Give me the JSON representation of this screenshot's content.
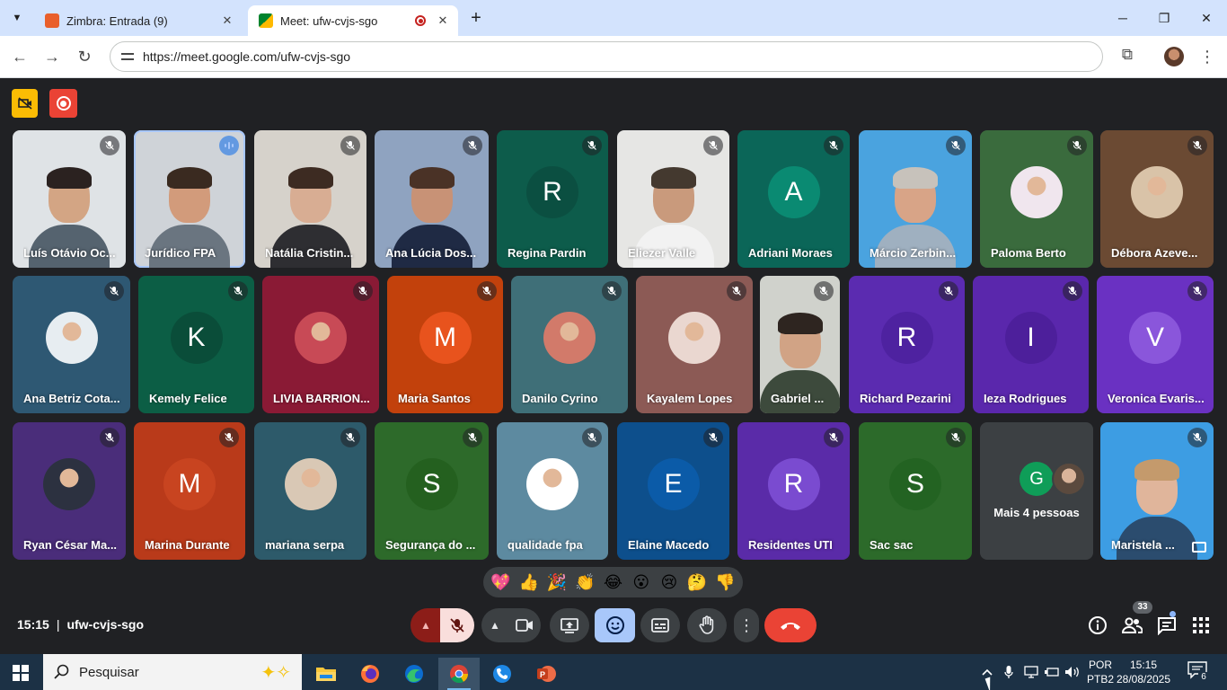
{
  "browser": {
    "tabs": [
      {
        "title": "Zimbra: Entrada (9)",
        "active": false,
        "favicon_color": "#e95f2b"
      },
      {
        "title": "Meet: ufw-cvjs-sgo",
        "active": true,
        "favicon_color": "#00832d"
      }
    ],
    "url": "https://meet.google.com/ufw-cvjs-sgo"
  },
  "meet": {
    "meeting_code": "ufw-cvjs-sgo",
    "time": "15:15",
    "time_separator": "|",
    "participants_count": "33",
    "overflow_label": "Mais 4 pessoas",
    "overflow_initial": "G",
    "reactions": [
      "💖",
      "👍",
      "🎉",
      "👏",
      "😂",
      "😮",
      "😢",
      "🤔",
      "👎"
    ],
    "tiles": [
      {
        "name": "Luís Otávio Oc...",
        "kind": "video",
        "bg": "#dfe3e6",
        "skin": "#d3a584",
        "hair": "#2b2220",
        "shirt": "#55636f",
        "speaking": false
      },
      {
        "name": "Jurídico FPA",
        "kind": "video",
        "bg": "#cfd3d8",
        "skin": "#d29b7b",
        "hair": "#3a2a20",
        "shirt": "#6a7580",
        "speaking": true
      },
      {
        "name": "Natália Cristin...",
        "kind": "video",
        "bg": "#d6d2cb",
        "skin": "#d8ad93",
        "hair": "#3d2b22",
        "shirt": "#2e2e32",
        "speaking": false
      },
      {
        "name": "Ana Lúcia Dos...",
        "kind": "video",
        "bg": "#8fa3c0",
        "skin": "#c89276",
        "hair": "#4a3226",
        "shirt": "#1f2a44",
        "speaking": false
      },
      {
        "name": "Regina Pardin",
        "kind": "initial",
        "initial": "R",
        "bg": "#0d5c4b",
        "avatar": "#0b4f41"
      },
      {
        "name": "Eliezer Valle",
        "kind": "video",
        "bg": "#e6e6e4",
        "skin": "#c99a7c",
        "hair": "#44392f",
        "shirt": "#f2f2f2",
        "speaking": false
      },
      {
        "name": "Adriani Moraes",
        "kind": "initial",
        "initial": "A",
        "bg": "#0b6658",
        "avatar": "#0a8a72"
      },
      {
        "name": "Márcio Zerbin...",
        "kind": "video",
        "bg": "#4aa3df",
        "skin": "#d8a487",
        "hair": "#c7c2bb",
        "shirt": "#9fb0c0",
        "speaking": false
      },
      {
        "name": "Paloma Berto",
        "kind": "photo",
        "bg": "#3a6b3d",
        "avatar": "#f0e6ee"
      },
      {
        "name": "Débora Azeve...",
        "kind": "photo",
        "bg": "#6b4a33",
        "avatar": "#d9c3a8"
      },
      {
        "name": "Ana Betriz Cota...",
        "kind": "photo",
        "bg": "#2e5873",
        "avatar": "#e7edf1"
      },
      {
        "name": "Kemely Felice",
        "kind": "initial",
        "initial": "K",
        "bg": "#0c5e45",
        "avatar": "#0a4d39"
      },
      {
        "name": "LIVIA BARRION...",
        "kind": "photo",
        "bg": "#8a1a35",
        "avatar": "#c84a56"
      },
      {
        "name": "Maria Santos",
        "kind": "initial",
        "initial": "M",
        "bg": "#c2410c",
        "avatar": "#e8531d"
      },
      {
        "name": "Danilo Cyrino",
        "kind": "photo",
        "bg": "#3f6f78",
        "avatar": "#d27a6a"
      },
      {
        "name": "Kayalem Lopes",
        "kind": "photo",
        "bg": "#8c5a55",
        "avatar": "#ead7d0"
      },
      {
        "name": "Gabriel ...",
        "kind": "video",
        "bg": "#d0d2cc",
        "skin": "#d1a385",
        "hair": "#2e2520",
        "shirt": "#3d4a3c",
        "speaking": false
      },
      {
        "name": "Richard Pezarini",
        "kind": "initial",
        "initial": "R",
        "bg": "#5b2bb0",
        "avatar": "#4e22a0"
      },
      {
        "name": "Ieza Rodrigues",
        "kind": "initial",
        "initial": "I",
        "bg": "#5a27ac",
        "avatar": "#4d1f9b"
      },
      {
        "name": "Veronica Evaris...",
        "kind": "initial",
        "initial": "V",
        "bg": "#6a31c2",
        "avatar": "#8a56db"
      },
      {
        "name": "Ryan César Ma...",
        "kind": "photo",
        "bg": "#4a2d7a",
        "avatar": "#2c3140"
      },
      {
        "name": "Marina Durante",
        "kind": "initial",
        "initial": "M",
        "bg": "#b93a1a",
        "avatar": "#c84420"
      },
      {
        "name": "mariana serpa",
        "kind": "photo",
        "bg": "#2d5a6a",
        "avatar": "#d9c8b5"
      },
      {
        "name": "Segurança do ...",
        "kind": "initial",
        "initial": "S",
        "bg": "#2d6a2a",
        "avatar": "#24601f"
      },
      {
        "name": "qualidade fpa",
        "kind": "photo",
        "bg": "#5d8aa0",
        "avatar": "#ffffff"
      },
      {
        "name": "Elaine Macedo",
        "kind": "initial",
        "initial": "E",
        "bg": "#0d4f8c",
        "avatar": "#0b5ba8"
      },
      {
        "name": "Residentes UTI",
        "kind": "initial",
        "initial": "R",
        "bg": "#5a2ba8",
        "avatar": "#7a4bd0"
      },
      {
        "name": "Sac sac",
        "kind": "initial",
        "initial": "S",
        "bg": "#2c6a2a",
        "avatar": "#236322"
      },
      {
        "name": "",
        "kind": "overflow",
        "bg": "#3c4043"
      },
      {
        "name": "Maristela ...",
        "kind": "video",
        "bg": "#3d9de3",
        "skin": "#e0b59b",
        "hair": "#c49a6c",
        "shirt": "#2b4c6e",
        "speaking": false
      }
    ]
  },
  "taskbar": {
    "search_placeholder": "Pesquisar",
    "lang_line1": "POR",
    "lang_line2": "PTB2",
    "clock_time": "15:15",
    "clock_date": "28/08/2025",
    "notifications": "6"
  }
}
